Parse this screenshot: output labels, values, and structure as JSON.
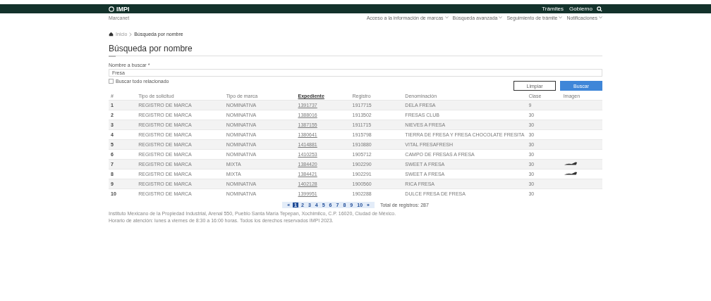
{
  "header": {
    "logo": "IMPI",
    "subtitle": "Marcanet",
    "links": [
      "Trámites",
      "Gobierno"
    ]
  },
  "nav": [
    "Acceso a la información de marcas",
    "Búsqueda avanzada",
    "Seguimiento de trámite",
    "Notificaciones"
  ],
  "breadcrumb": [
    "Inicio",
    "Búsqueda por nombre"
  ],
  "title": "Búsqueda por nombre",
  "form": {
    "label": "Nombre a buscar *",
    "value": "Fresa",
    "option": {
      "label": "Buscar todo relacionado",
      "checked": false
    },
    "buttons": [
      "Limpiar",
      "Buscar"
    ]
  },
  "table": {
    "columns": [
      "#",
      "Tipo de solicitud",
      "Tipo de marca",
      "Expediente",
      "Registro",
      "Denominación",
      "Clase",
      "Imagen"
    ],
    "rows": [
      {
        "cells": [
          "1",
          "REGISTRO DE MARCA",
          "NOMINATIVA",
          "1391737",
          "1917715",
          "DELA FRESA",
          "9"
        ],
        "has_image": false
      },
      {
        "cells": [
          "2",
          "REGISTRO DE MARCA",
          "NOMINATIVA",
          "1388016",
          "1913502",
          "FRESAS CLUB",
          "30"
        ],
        "has_image": false
      },
      {
        "cells": [
          "3",
          "REGISTRO DE MARCA",
          "NOMINATIVA",
          "1387155",
          "1911715",
          "NIEVES A FRESA",
          "30"
        ],
        "has_image": false
      },
      {
        "cells": [
          "4",
          "REGISTRO DE MARCA",
          "NOMINATIVA",
          "1380641",
          "1915798",
          "TIERRA DE FRESA Y FRESA CHOCOLATE FRESITA",
          "30"
        ],
        "has_image": false
      },
      {
        "cells": [
          "5",
          "REGISTRO DE MARCA",
          "NOMINATIVA",
          "1414881",
          "1910880",
          "VITAL FRESAFRESH",
          "30"
        ],
        "has_image": false
      },
      {
        "cells": [
          "6",
          "REGISTRO DE MARCA",
          "NOMINATIVA",
          "1410253",
          "1905712",
          "CAMPO DE FRESAS A FRESA",
          "30"
        ],
        "has_image": false
      },
      {
        "cells": [
          "7",
          "REGISTRO DE MARCA",
          "MIXTA",
          "1384420",
          "1902290",
          "SWEET A FRESA",
          "30"
        ],
        "has_image": true
      },
      {
        "cells": [
          "8",
          "REGISTRO DE MARCA",
          "MIXTA",
          "1384421",
          "1902291",
          "SWEET A FRESA",
          "30"
        ],
        "has_image": true
      },
      {
        "cells": [
          "9",
          "REGISTRO DE MARCA",
          "NOMINATIVA",
          "1402128",
          "1900560",
          "RICA FRESA",
          "30"
        ],
        "has_image": false
      },
      {
        "cells": [
          "10",
          "REGISTRO DE MARCA",
          "NOMINATIVA",
          "1399951",
          "1902288",
          "DULCE FRESA DE FRESA",
          "30"
        ],
        "has_image": false
      }
    ]
  },
  "pagination": {
    "pages": [
      {
        "label": "«",
        "selected": false
      },
      {
        "label": "1",
        "selected": true
      },
      {
        "label": "2",
        "selected": false
      },
      {
        "label": "3",
        "selected": false
      },
      {
        "label": "4",
        "selected": false
      },
      {
        "label": "5",
        "selected": false
      },
      {
        "label": "6",
        "selected": false
      },
      {
        "label": "7",
        "selected": false
      },
      {
        "label": "8",
        "selected": false
      },
      {
        "label": "9",
        "selected": false
      },
      {
        "label": "10",
        "selected": false
      },
      {
        "label": "»",
        "selected": false
      }
    ],
    "total": "Total de registros: 287"
  },
  "footer": [
    "Instituto Mexicano de la Propiedad Industrial, Arenal 550, Pueblo Santa María Tepepan, Xochimilco, C.P. 16020, Ciudad de México.",
    "Horario de atención: lunes a viernes de 8:30 a 16:00 horas. Todos los derechos reservados IMPI 2023."
  ]
}
